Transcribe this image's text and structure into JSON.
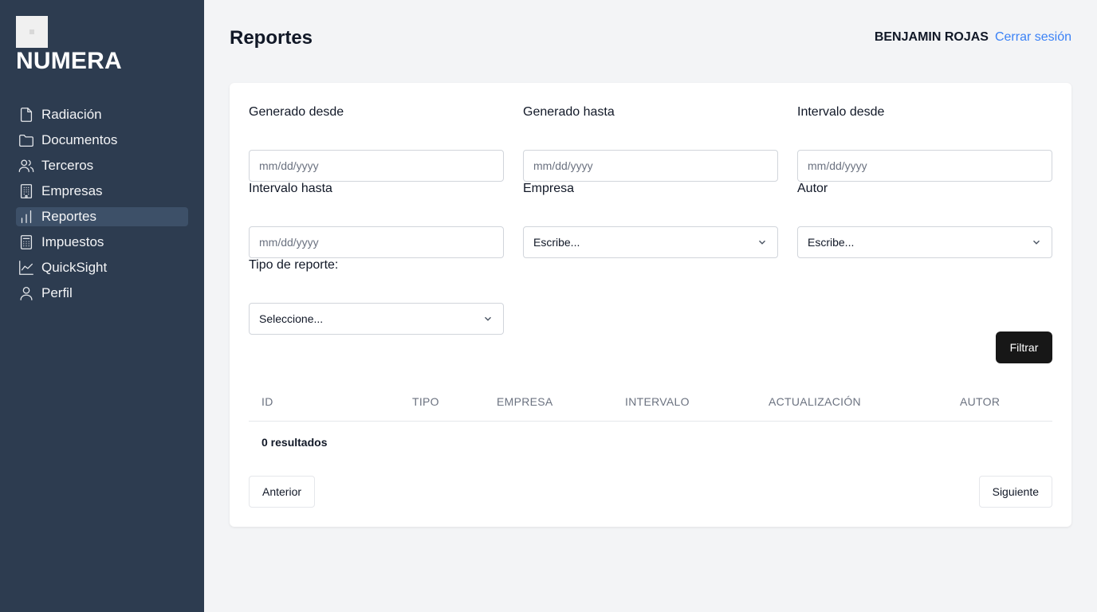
{
  "sidebar": {
    "brand": "NUMERA",
    "items": [
      {
        "label": "Radiación",
        "icon": "file-icon",
        "active": false
      },
      {
        "label": "Documentos",
        "icon": "folder-icon",
        "active": false
      },
      {
        "label": "Terceros",
        "icon": "users-icon",
        "active": false
      },
      {
        "label": "Empresas",
        "icon": "building-icon",
        "active": false
      },
      {
        "label": "Reportes",
        "icon": "bar-chart-icon",
        "active": true
      },
      {
        "label": "Impuestos",
        "icon": "calculator-icon",
        "active": false
      },
      {
        "label": "QuickSight",
        "icon": "line-chart-icon",
        "active": false
      },
      {
        "label": "Perfil",
        "icon": "user-icon",
        "active": false
      }
    ]
  },
  "header": {
    "title": "Reportes",
    "user_name": "BENJAMIN ROJAS",
    "logout_label": "Cerrar sesión"
  },
  "filters": {
    "generado_desde": {
      "label": "Generado desde",
      "placeholder": "mm/dd/yyyy"
    },
    "generado_hasta": {
      "label": "Generado hasta",
      "placeholder": "mm/dd/yyyy"
    },
    "intervalo_desde": {
      "label": "Intervalo desde",
      "placeholder": "mm/dd/yyyy"
    },
    "intervalo_hasta": {
      "label": "Intervalo hasta",
      "placeholder": "mm/dd/yyyy"
    },
    "empresa": {
      "label": "Empresa",
      "value": "Escribe..."
    },
    "autor": {
      "label": "Autor",
      "value": "Escribe..."
    },
    "tipo_reporte": {
      "label": "Tipo de reporte:",
      "value": "Seleccione..."
    },
    "filter_button": "Filtrar"
  },
  "table": {
    "columns": [
      "ID",
      "TIPO",
      "EMPRESA",
      "INTERVALO",
      "ACTUALIZACIÓN",
      "AUTOR"
    ],
    "rows": [],
    "result_count": "0 resultados"
  },
  "pagination": {
    "previous_label": "Anterior",
    "next_label": "Siguiente"
  },
  "colors": {
    "sidebar_bg": "#2d3c50",
    "sidebar_active": "#3d5068",
    "page_bg": "#f3f4f6",
    "link": "#3b82f6",
    "primary_button": "#171717"
  }
}
